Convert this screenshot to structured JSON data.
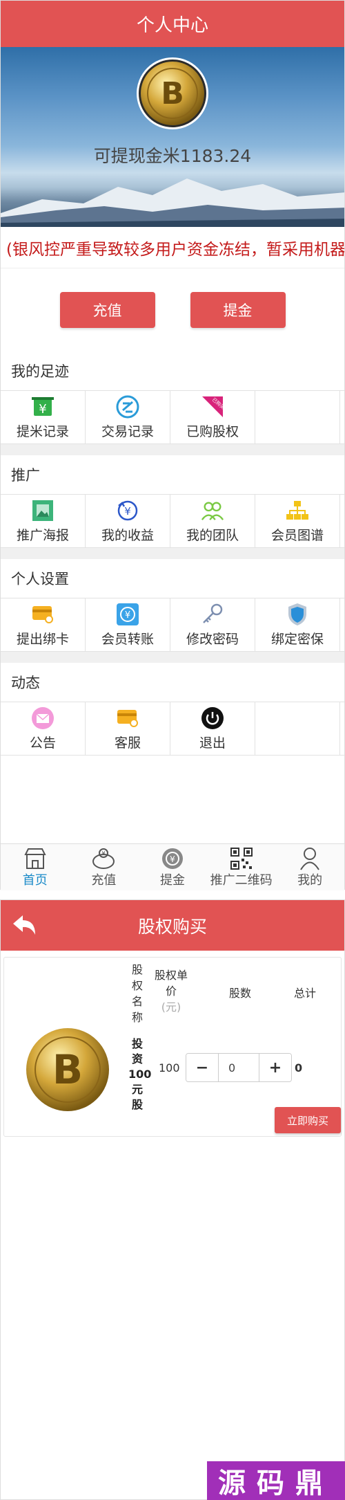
{
  "profile": {
    "header_title": "个人中心",
    "withdrawable_text": "可提现金米1183.24",
    "marquee_text": "(银风控严重导致较多用户资金冻结，暂采用机器",
    "recharge_label": "充值",
    "withdraw_label": "提金"
  },
  "footprint": {
    "title": "我的足迹",
    "items": [
      {
        "label": "提米记录",
        "icon": "atm-yuan-icon"
      },
      {
        "label": "交易记录",
        "icon": "exchange-icon"
      },
      {
        "label": "已购股权",
        "icon": "purchased-badge-icon",
        "badge": "已购买"
      },
      {
        "label": ""
      }
    ]
  },
  "promotion": {
    "title": "推广",
    "items": [
      {
        "label": "推广海报",
        "icon": "poster-icon"
      },
      {
        "label": "我的收益",
        "icon": "income-icon"
      },
      {
        "label": "我的团队",
        "icon": "team-icon"
      },
      {
        "label": "会员图谱",
        "icon": "org-chart-icon"
      }
    ]
  },
  "settings": {
    "title": "个人设置",
    "items": [
      {
        "label": "提出绑卡",
        "icon": "card-icon"
      },
      {
        "label": "会员转账",
        "icon": "transfer-icon"
      },
      {
        "label": "修改密码",
        "icon": "key-icon"
      },
      {
        "label": "绑定密保",
        "icon": "shield-icon"
      }
    ]
  },
  "news": {
    "title": "动态",
    "items": [
      {
        "label": "公告",
        "icon": "envelope-icon"
      },
      {
        "label": "客服",
        "icon": "service-card-icon"
      },
      {
        "label": "退出",
        "icon": "power-icon"
      },
      {
        "label": ""
      }
    ]
  },
  "tabbar": {
    "items": [
      {
        "label": "首页",
        "icon": "store-icon"
      },
      {
        "label": "充值",
        "icon": "piggy-icon"
      },
      {
        "label": "提金",
        "icon": "coin-icon"
      },
      {
        "label": "推广二维码",
        "icon": "qrcode-icon"
      },
      {
        "label": "我的",
        "icon": "user-icon"
      }
    ]
  },
  "purchase": {
    "header_title": "股权购买",
    "col_name": "股权名称",
    "col_price": "股权单价",
    "col_price_unit": "(元)",
    "col_qty": "股数",
    "col_total": "总计",
    "product_name": "投资100元股",
    "price": "100",
    "qty": "0",
    "total": "0",
    "buy_label": "立即购买"
  },
  "watermark": "源码鼎",
  "colors": {
    "accent": "#e15353",
    "active_tab": "#1a8ac8",
    "marquee": "#c41a1a"
  }
}
